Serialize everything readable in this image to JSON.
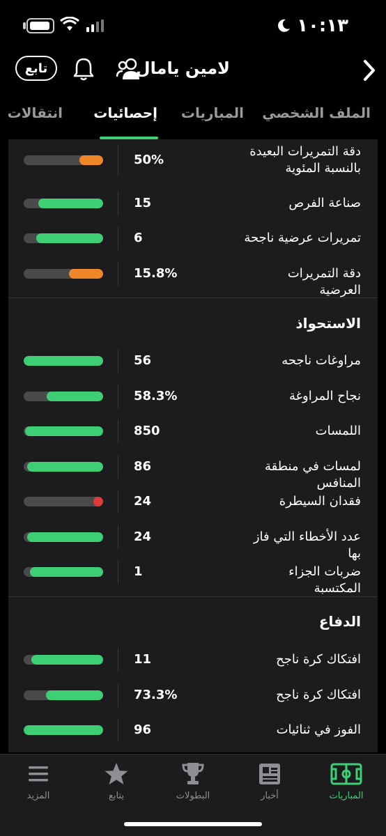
{
  "status_bar": {
    "time": "١٠:١٣"
  },
  "header": {
    "player_name": "لامين يامال",
    "follow_label": "تابع"
  },
  "tabs": [
    {
      "label": "الملف الشخصي",
      "active": false
    },
    {
      "label": "المباريات",
      "active": false
    },
    {
      "label": "إحصائيات",
      "active": true
    },
    {
      "label": "انتقالات",
      "active": false
    }
  ],
  "colors": {
    "accent": "#3ecf74",
    "orange": "#f0862a",
    "red": "#e03b3b",
    "track": "#4a4a4c"
  },
  "passing_rows": [
    {
      "label": "دقة التمريرات البعيدة بالنسبة المئوية",
      "value": "50%",
      "fill": 0.3,
      "color": "orange"
    },
    {
      "label": "صناعة الفرص",
      "value": "15",
      "fill": 0.82,
      "color": "green"
    },
    {
      "label": "تمريرات عرضية ناجحة",
      "value": "6",
      "fill": 0.84,
      "color": "green"
    },
    {
      "label": "دقة التمريرات العرضية",
      "value": "15.8%",
      "fill": 0.43,
      "color": "orange"
    }
  ],
  "possession": {
    "title": "الاستحواذ",
    "rows": [
      {
        "label": "مراوغات ناجحه",
        "value": "56",
        "fill": 1.0,
        "color": "green"
      },
      {
        "label": "نجاح المراوغة",
        "value": "58.3%",
        "fill": 0.71,
        "color": "green"
      },
      {
        "label": "اللمسات",
        "value": "850",
        "fill": 0.98,
        "color": "green"
      },
      {
        "label": "لمسات في منطقة المنافس",
        "value": "86",
        "fill": 0.96,
        "color": "green"
      },
      {
        "label": "فقدان السيطرة",
        "value": "24",
        "fill": 0.0,
        "color": "red"
      },
      {
        "label": "عدد الأخطاء التي فاز بها",
        "value": "24",
        "fill": 0.96,
        "color": "green"
      },
      {
        "label": "ضربات الجزاء المكتسبة",
        "value": "1",
        "fill": 0.92,
        "color": "green"
      }
    ]
  },
  "defense": {
    "title": "الدفاع",
    "rows": [
      {
        "label": "افتكاك كرة ناجح",
        "value": "11",
        "fill": 0.9,
        "color": "green"
      },
      {
        "label": "افتكاك كرة ناجح",
        "value": "73.3%",
        "fill": 0.72,
        "color": "green"
      },
      {
        "label": "الفوز في ثنائيات",
        "value": "96",
        "fill": 1.0,
        "color": "green"
      }
    ]
  },
  "bottom_nav": [
    {
      "label": "المباريات",
      "icon": "pitch-icon",
      "active": true
    },
    {
      "label": "أخبار",
      "icon": "news-icon",
      "active": false
    },
    {
      "label": "البطولات",
      "icon": "trophy-icon",
      "active": false
    },
    {
      "label": "يتابع",
      "icon": "star-icon",
      "active": false
    },
    {
      "label": "المزيد",
      "icon": "menu-icon",
      "active": false
    }
  ]
}
